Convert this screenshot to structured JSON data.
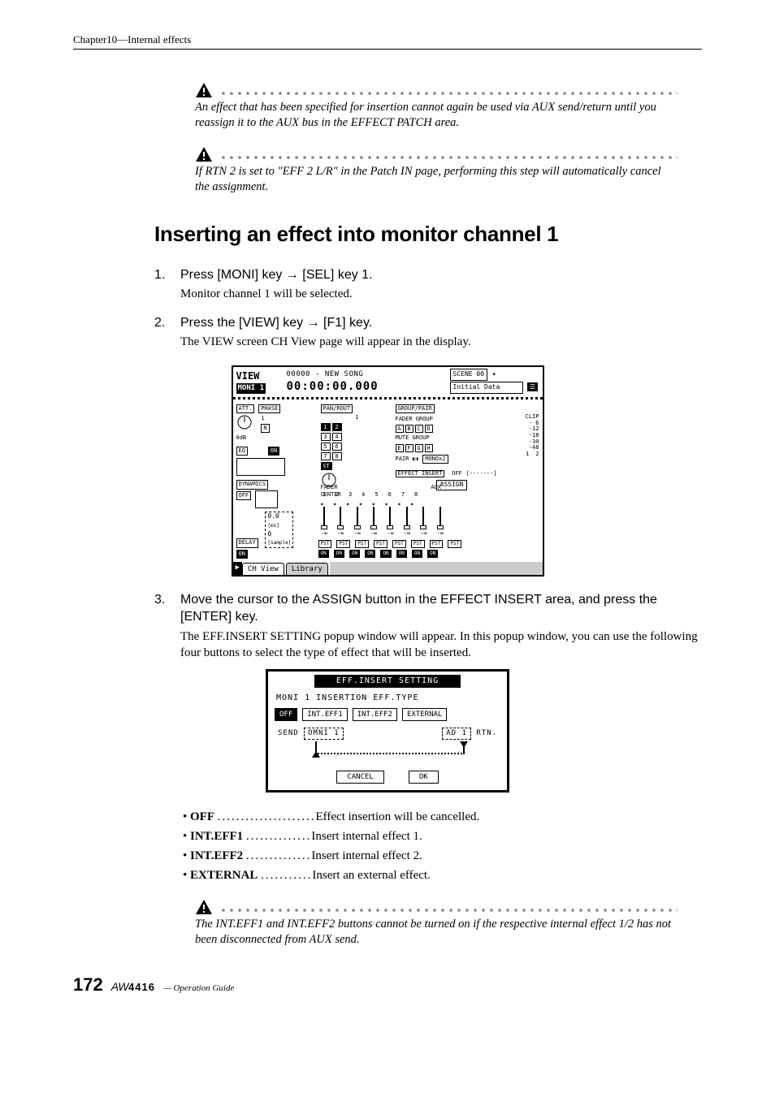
{
  "header": {
    "chapter": "Chapter10—Internal effects"
  },
  "warnings": {
    "w1": "An effect that has been specified for insertion cannot again be used via AUX send/return until you reassign it to the AUX bus in the EFFECT PATCH area.",
    "w2": "If RTN 2 is set to \"EFF 2 L/R\" in the Patch IN page, performing this step will automatically cancel the assignment.",
    "w3": "The INT.EFF1 and INT.EFF2 buttons cannot be turned on if the respective internal effect 1/2 has not been disconnected from AUX send."
  },
  "heading": "Inserting an effect into monitor channel 1",
  "steps": {
    "s1": {
      "num": "1.",
      "title": "Press [MONI] key → [SEL] key 1.",
      "desc": "Monitor channel 1 will be selected."
    },
    "s2": {
      "num": "2.",
      "title": "Press the [VIEW] key → [F1] key.",
      "desc": "The VIEW screen CH View page will appear in the display."
    },
    "s3": {
      "num": "3.",
      "title": "Move the cursor to the ASSIGN button in the EFFECT INSERT area, and press the [ENTER] key.",
      "desc": "The EFF.INSERT SETTING popup window will appear. In this popup window, you can use the following four buttons to select the type of effect that will be inserted."
    }
  },
  "view_screen": {
    "title_left_1": "VIEW",
    "title_left_2": "MONI 1",
    "song": "00000 - NEW SONG",
    "timecode": "00:00:00.000",
    "scene_num": "SCENE 00",
    "scene_name": "Initial Data",
    "sections": {
      "att": "ATT.",
      "phase": "PHASE",
      "panrout": "PAN/ROUT",
      "grouppair": "GROUP/PAIR",
      "eq": "EQ",
      "dynamics": "DYNAMICS",
      "delay": "DELAY",
      "fadergroup": "FADER GROUP",
      "mutegroup": "MUTE GROUP",
      "pair": "PAIR",
      "effins": "EFFECT INSERT",
      "assign": "ASSIGN",
      "fader": "FADER",
      "aux": "AUX"
    },
    "att_value": "0dB",
    "phase_state": "N",
    "eq_state": "ON",
    "dyn_state": "OFF",
    "delay_ms": "0.0",
    "delay_ms_u": "[ms]",
    "delay_smp": "0",
    "delay_smp_u": "[sample]",
    "delay_state": "ON",
    "pan_center": "CENTER",
    "st_label": "ST",
    "rout": [
      "1",
      "2",
      "3",
      "4",
      "5",
      "6",
      "7",
      "8"
    ],
    "fgroups": [
      "A",
      "B",
      "C",
      "D"
    ],
    "mgroups": [
      "E",
      "F",
      "G",
      "H"
    ],
    "pair_mono": "MONOx2",
    "effins_state": "OFF",
    "meter_clip": "CLIP",
    "meter_ticks": [
      "- 6",
      "-12",
      "-18",
      "-30",
      "-48"
    ],
    "meter_ch": [
      "1",
      "2"
    ],
    "aux_nums": [
      "1",
      "2",
      "3",
      "4",
      "5",
      "6",
      "7",
      "8"
    ],
    "fader_inf": "-∞",
    "pst": "PST",
    "on": "ON",
    "tabs": {
      "chview": "CH View",
      "library": "Library"
    },
    "tab_icon": "▶"
  },
  "popup": {
    "title": "EFF.INSERT SETTING",
    "channel": "MONI  1   INSERTION EFF.TYPE",
    "buttons": {
      "off": "OFF",
      "int1": "INT.EFF1",
      "int2": "INT.EFF2",
      "ext": "EXTERNAL"
    },
    "send_label": "SEND",
    "send_val": "OMNI     1",
    "rtn_val": "AD       1",
    "rtn_label": "RTN.",
    "cancel": "CANCEL",
    "ok": "OK"
  },
  "bullets": {
    "off": {
      "key": "OFF",
      "dots": ".....................",
      "desc": "Effect insertion will be cancelled."
    },
    "int1": {
      "key": "INT.EFF1",
      "dots": "..............",
      "desc": "Insert internal effect 1."
    },
    "int2": {
      "key": "INT.EFF2",
      "dots": "..............",
      "desc": "Insert internal effect 2."
    },
    "ext": {
      "key": "EXTERNAL",
      "dots": "...........",
      "desc": "Insert an external effect."
    }
  },
  "footer": {
    "page": "172",
    "brand_italic": "AW",
    "brand_num": "4416",
    "guide": "— Operation Guide"
  }
}
